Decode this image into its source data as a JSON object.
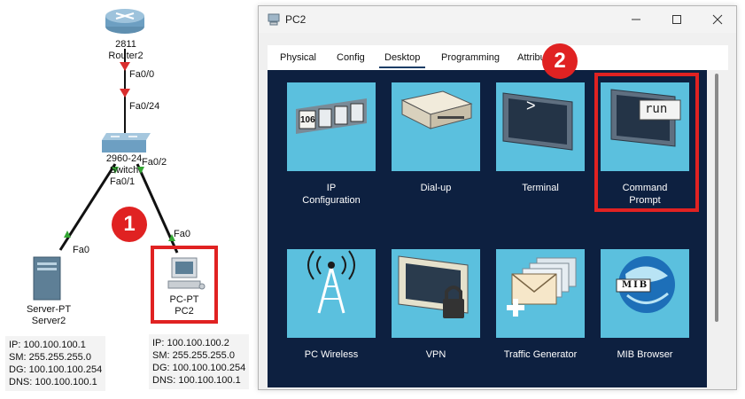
{
  "topology": {
    "router": {
      "model": "2811",
      "name": "Router2"
    },
    "switch": {
      "model": "2960-24",
      "name": "Switch"
    },
    "server": {
      "model": "Server-PT",
      "name": "Server2"
    },
    "pc": {
      "model": "PC-PT",
      "name": "PC2"
    },
    "ports": {
      "router_fa00": "Fa0/0",
      "switch_fa024": "Fa0/24",
      "switch_fa01": "Fa0/1",
      "switch_fa02": "Fa0/2",
      "server_fa0": "Fa0",
      "pc_fa0": "Fa0"
    },
    "server_ip": {
      "ip": "IP: 100.100.100.1",
      "sm": "SM: 255.255.255.0",
      "dg": "DG: 100.100.100.254",
      "dns": "DNS: 100.100.100.1"
    },
    "pc_ip": {
      "ip": "IP: 100.100.100.2",
      "sm": "SM: 255.255.255.0",
      "dg": "DG: 100.100.100.254",
      "dns": "DNS: 100.100.100.1"
    },
    "badge1": "1"
  },
  "window": {
    "title": "PC2",
    "badge2": "2",
    "tabs": [
      "Physical",
      "Config",
      "Desktop",
      "Programming",
      "Attribu"
    ],
    "active_tab": "Desktop",
    "apps": {
      "ip_config": {
        "line1": "IP",
        "line2": "Configuration",
        "glyph": "106"
      },
      "dialup": {
        "label": "Dial-up"
      },
      "terminal": {
        "label": "Terminal",
        "glyph": ">"
      },
      "cmd": {
        "line1": "Command",
        "line2": "Prompt",
        "glyph": "run"
      },
      "wireless": {
        "label": "PC Wireless"
      },
      "vpn": {
        "label": "VPN"
      },
      "traffic": {
        "label": "Traffic Generator"
      },
      "mib": {
        "label": "MIB Browser",
        "glyph": "MIB"
      }
    }
  },
  "colors": {
    "accent_red": "#e02222",
    "tile_blue": "#5bc0de",
    "panel_navy": "#0d2040"
  }
}
